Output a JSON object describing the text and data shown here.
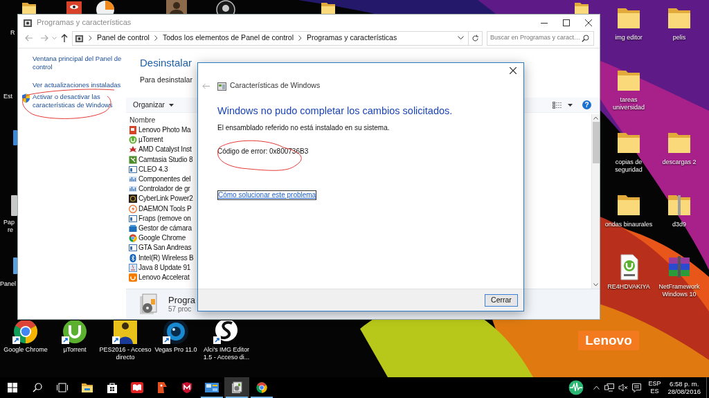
{
  "desktop": {
    "logo": "Lenovo",
    "edge_labels": [
      "R",
      "Est",
      "Pap",
      "re",
      "Panel"
    ],
    "icons": [
      {
        "label_lines": [
          "img editor"
        ],
        "kind": "folder",
        "shortcut": false
      },
      {
        "label_lines": [
          "pelis"
        ],
        "kind": "folder",
        "shortcut": false
      },
      {
        "label_lines": [
          "tareas",
          "universidad"
        ],
        "kind": "folder",
        "shortcut": false
      },
      {
        "label_lines": [
          "copias de",
          "seguridad"
        ],
        "kind": "folder",
        "shortcut": false
      },
      {
        "label_lines": [
          "descargas 2"
        ],
        "kind": "folder",
        "shortcut": false
      },
      {
        "label_lines": [
          "ondas binaurales"
        ],
        "kind": "folder",
        "shortcut": false
      },
      {
        "label_lines": [
          "d3d9"
        ],
        "kind": "zip",
        "shortcut": false
      },
      {
        "label_lines": [
          "RE4HDVAKIYA"
        ],
        "kind": "torrent_file",
        "shortcut": false
      },
      {
        "label_lines": [
          "NetFramework",
          "Windows 10"
        ],
        "kind": "archive",
        "shortcut": false
      },
      {
        "label_lines": [
          "Google Chrome"
        ],
        "kind": "chrome",
        "shortcut": true
      },
      {
        "label_lines": [
          "µTorrent"
        ],
        "kind": "utorrent",
        "shortcut": true
      },
      {
        "label_lines": [
          "PES2016 - Acceso",
          "directo"
        ],
        "kind": "game",
        "shortcut": true
      },
      {
        "label_lines": [
          "Vegas Pro 11.0"
        ],
        "kind": "lens",
        "shortcut": true
      },
      {
        "label_lines": [
          "Alci's IMG Editor",
          "1.5 - Acceso di..."
        ],
        "kind": "emblem",
        "shortcut": true
      }
    ]
  },
  "window": {
    "title": "Programas y características",
    "breadcrumbs": [
      "Panel de control",
      "Todos los elementos de Panel de control",
      "Programas y características"
    ],
    "search_placeholder": "Buscar en Programas y caract…",
    "sidebar_links": [
      {
        "text": "Ventana principal del Panel de control",
        "shield": false
      },
      {
        "text": "Ver actualizaciones instaladas",
        "shield": false
      },
      {
        "text": "Activar o desactivar las características de Windows",
        "shield": true
      }
    ],
    "heading": "Desinstalar",
    "subtext": "Para desinstalar",
    "organize": "Organizar",
    "help_glyph": "?",
    "column": "Nombre",
    "programs": [
      {
        "name": "Lenovo Photo Ma",
        "kind": "lenovo_photo"
      },
      {
        "name": "µTorrent",
        "kind": "utorrent"
      },
      {
        "name": "AMD Catalyst Inst",
        "kind": "amd"
      },
      {
        "name": "Camtasia Studio 8",
        "kind": "camtasia"
      },
      {
        "name": "CLEO 4.3",
        "kind": "window_blue"
      },
      {
        "name": "Componentes del",
        "kind": "components"
      },
      {
        "name": "Controlador de gr",
        "kind": "components"
      },
      {
        "name": "CyberLink Power2",
        "kind": "cyberlink"
      },
      {
        "name": "DAEMON Tools P",
        "kind": "daemon"
      },
      {
        "name": "Fraps (remove on",
        "kind": "window_blue"
      },
      {
        "name": "Gestor de cámara",
        "kind": "camera"
      },
      {
        "name": "Google Chrome",
        "kind": "chrome"
      },
      {
        "name": "GTA San Andreas",
        "kind": "window_blue"
      },
      {
        "name": "Intel(R) Wireless B",
        "kind": "bluetooth"
      },
      {
        "name": "Java 8 Update 91",
        "kind": "java"
      },
      {
        "name": "Lenovo Accelerat",
        "kind": "accelerator"
      }
    ],
    "details": {
      "title": "Progra",
      "count": "57 proc"
    }
  },
  "dialog": {
    "title": "Características de Windows",
    "heading": "Windows no pudo completar los cambios solicitados.",
    "message": "El ensamblado referido no está instalado en su sistema.",
    "error_code": "Código de error: 0x800736B3",
    "help_link": "Cómo solucionar este problema",
    "button": "Cerrar"
  },
  "taskbar": {
    "buttons": [
      {
        "kind": "start",
        "running": false,
        "selected": false
      },
      {
        "kind": "search",
        "running": false,
        "selected": false
      },
      {
        "kind": "task_view",
        "running": false,
        "selected": false
      },
      {
        "kind": "explorer",
        "running": false,
        "selected": false
      },
      {
        "kind": "store",
        "running": false,
        "selected": false
      },
      {
        "kind": "book",
        "running": false,
        "selected": false
      },
      {
        "kind": "mascot",
        "running": false,
        "selected": false
      },
      {
        "kind": "shield",
        "running": false,
        "selected": false
      },
      {
        "kind": "control_panel",
        "running": true,
        "selected": false
      },
      {
        "kind": "programs",
        "running": true,
        "selected": true
      },
      {
        "kind": "chrome",
        "running": true,
        "selected": false
      }
    ],
    "language_top": "ESP",
    "language_bottom": "ES",
    "time": "6:58 p. m.",
    "date": "28/08/2016"
  }
}
